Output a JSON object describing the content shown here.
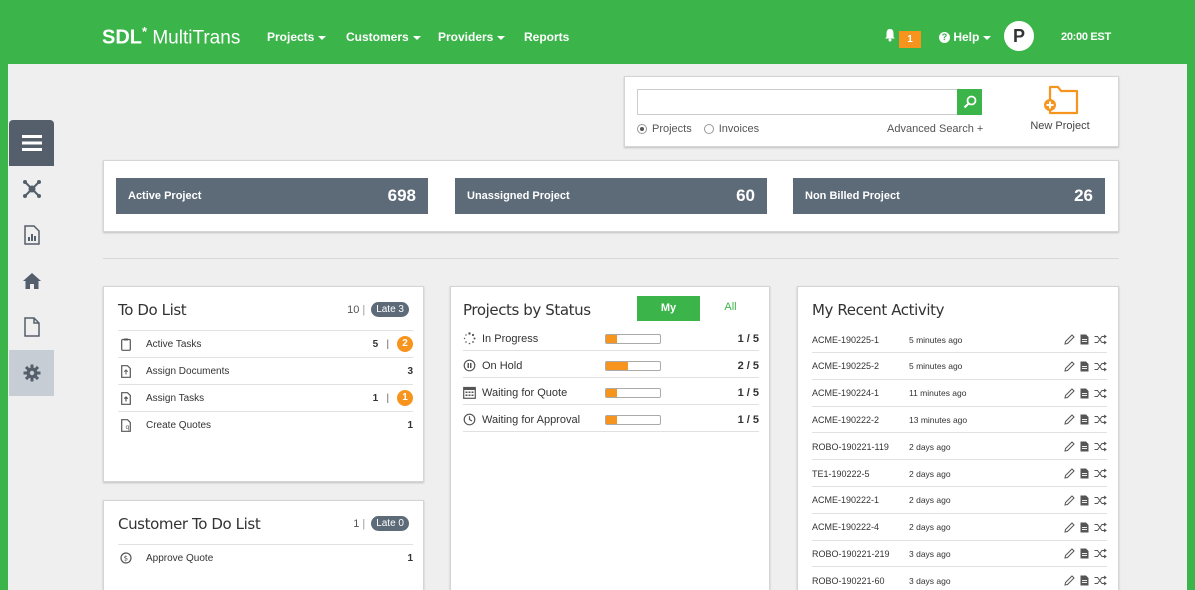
{
  "app": {
    "brand": "SDL",
    "brand_suffix": "MultiTrans"
  },
  "nav": [
    {
      "label": "Projects",
      "dropdown": true
    },
    {
      "label": "Customers",
      "dropdown": true
    },
    {
      "label": "Providers",
      "dropdown": true
    },
    {
      "label": "Reports",
      "dropdown": false
    }
  ],
  "header": {
    "notifications": "1",
    "help_label": "Help",
    "avatar_initial": "P",
    "time": "20:00 EST"
  },
  "search": {
    "placeholder": "",
    "options": [
      {
        "label": "Projects",
        "selected": true
      },
      {
        "label": "Invoices",
        "selected": false
      }
    ],
    "advanced_label": "Advanced Search +",
    "new_project_label": "New Project"
  },
  "stats": [
    {
      "label": "Active Project",
      "value": "698"
    },
    {
      "label": "Unassigned Project",
      "value": "60"
    },
    {
      "label": "Non Billed Project",
      "value": "26"
    }
  ],
  "todo": {
    "title": "To Do List",
    "count": "10",
    "late_label": "Late 3",
    "items": [
      {
        "label": "Active Tasks",
        "count": "5",
        "late": "2"
      },
      {
        "label": "Assign Documents",
        "count": "3",
        "late": ""
      },
      {
        "label": "Assign Tasks",
        "count": "1",
        "late": "1"
      },
      {
        "label": "Create Quotes",
        "count": "1",
        "late": ""
      }
    ]
  },
  "customer_todo": {
    "title": "Customer To Do List",
    "count": "1",
    "late_label": "Late 0",
    "items": [
      {
        "label": "Approve Quote",
        "count": "1"
      }
    ]
  },
  "status": {
    "title": "Projects by Status",
    "tab_my": "My",
    "tab_all": "All",
    "items": [
      {
        "label": "In Progress",
        "count": "1 / 5",
        "fraction": 0.2
      },
      {
        "label": "On Hold",
        "count": "2 / 5",
        "fraction": 0.4
      },
      {
        "label": "Waiting for Quote",
        "count": "1 / 5",
        "fraction": 0.2
      },
      {
        "label": "Waiting for Approval",
        "count": "1 / 5",
        "fraction": 0.2
      }
    ]
  },
  "activity": {
    "title": "My Recent Activity",
    "items": [
      {
        "id": "ACME-190225-1",
        "time": "5 minutes ago"
      },
      {
        "id": "ACME-190225-2",
        "time": "5 minutes ago"
      },
      {
        "id": "ACME-190224-1",
        "time": "11 minutes ago"
      },
      {
        "id": "ACME-190222-2",
        "time": "13 minutes ago"
      },
      {
        "id": "ROBO-190221-119",
        "time": "2 days ago"
      },
      {
        "id": "TE1-190222-5",
        "time": "2 days ago"
      },
      {
        "id": "ACME-190222-1",
        "time": "2 days ago"
      },
      {
        "id": "ACME-190222-4",
        "time": "2 days ago"
      },
      {
        "id": "ROBO-190221-219",
        "time": "3 days ago"
      },
      {
        "id": "ROBO-190221-60",
        "time": "3 days ago"
      }
    ]
  },
  "colors": {
    "brand_green": "#3bb54a",
    "accent_orange": "#f7941d",
    "slate": "#5d6b79"
  }
}
